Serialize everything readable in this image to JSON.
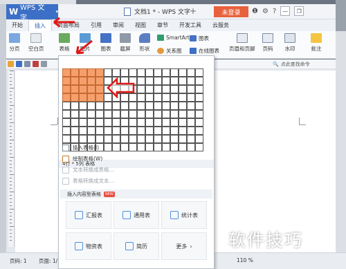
{
  "window": {
    "app_tab": "WPS 文字",
    "doc_title": "文档1 * - WPS 文字",
    "login_button": "未登录"
  },
  "menu": {
    "tabs": [
      "开始",
      "插入",
      "页面布局",
      "引用",
      "审阅",
      "视图",
      "章节",
      "开发工具",
      "云服务"
    ],
    "active": "插入"
  },
  "ribbon": {
    "page_break": "分页",
    "blank_page": "空白页",
    "table": "表格",
    "picture": "图片",
    "chart": "图表",
    "screenshot": "截屏",
    "shapes": "形状",
    "smartart": "SmartArt",
    "chart_small": "图表",
    "relation": "关系图",
    "online_chart": "在线图表",
    "header_footer": "页眉和页脚",
    "page_number": "页码",
    "watermark": "水印",
    "comment": "批注"
  },
  "quickbar": {
    "start_tab": "开始",
    "search": "点此查找命令"
  },
  "dropdown": {
    "grid_caption": "4行 * 5列 表格",
    "grid_rows": 10,
    "grid_cols": 17,
    "selected_rows": 4,
    "selected_cols": 5,
    "menu_items": [
      {
        "label": "插入表格(I)",
        "disabled": false
      },
      {
        "label": "绘制表格(W)",
        "disabled": false
      },
      {
        "label": "文本转换成表格...",
        "disabled": true
      },
      {
        "label": "表格转换成文本...",
        "disabled": true
      }
    ],
    "section_title": "插入内容型表格",
    "new_badge": "NEW",
    "templates": [
      "汇报表",
      "通用表",
      "统计表",
      "物资表",
      "简历",
      "更多"
    ]
  },
  "statusbar": {
    "page": "页码: 1",
    "pages": "页面: 1/1",
    "zoom": "110 %"
  },
  "watermark_text": "软件技巧",
  "colors": {
    "wps_blue": "#3c70c6",
    "login_red": "#e8603c",
    "cell_selected": "#f5a06c",
    "arrow_red": "#e01818"
  }
}
